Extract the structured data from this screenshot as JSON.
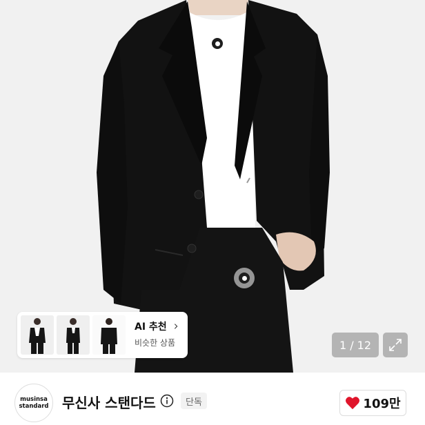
{
  "product_image": {
    "alt": "",
    "hotspots": [
      "hotspot-chest",
      "hotspot-waist"
    ]
  },
  "ai_recommend": {
    "title": "AI 추천",
    "subtitle": "비슷한 상품",
    "thumbnails": [
      "suit-front-thumbnail",
      "suit-side-thumbnail",
      "suit-back-thumbnail"
    ]
  },
  "gallery": {
    "counter": "1 / 12"
  },
  "brand": {
    "logo_line1": "musinsa",
    "logo_line2": "standard",
    "name": "무신사 스탠다드",
    "badge": "단독"
  },
  "like": {
    "count": "109만",
    "icon": "heart-icon",
    "color": "#e0152b"
  },
  "colors": {
    "jacket": "#121212",
    "background": "#f1f1f1",
    "heart": "#e0152b"
  }
}
